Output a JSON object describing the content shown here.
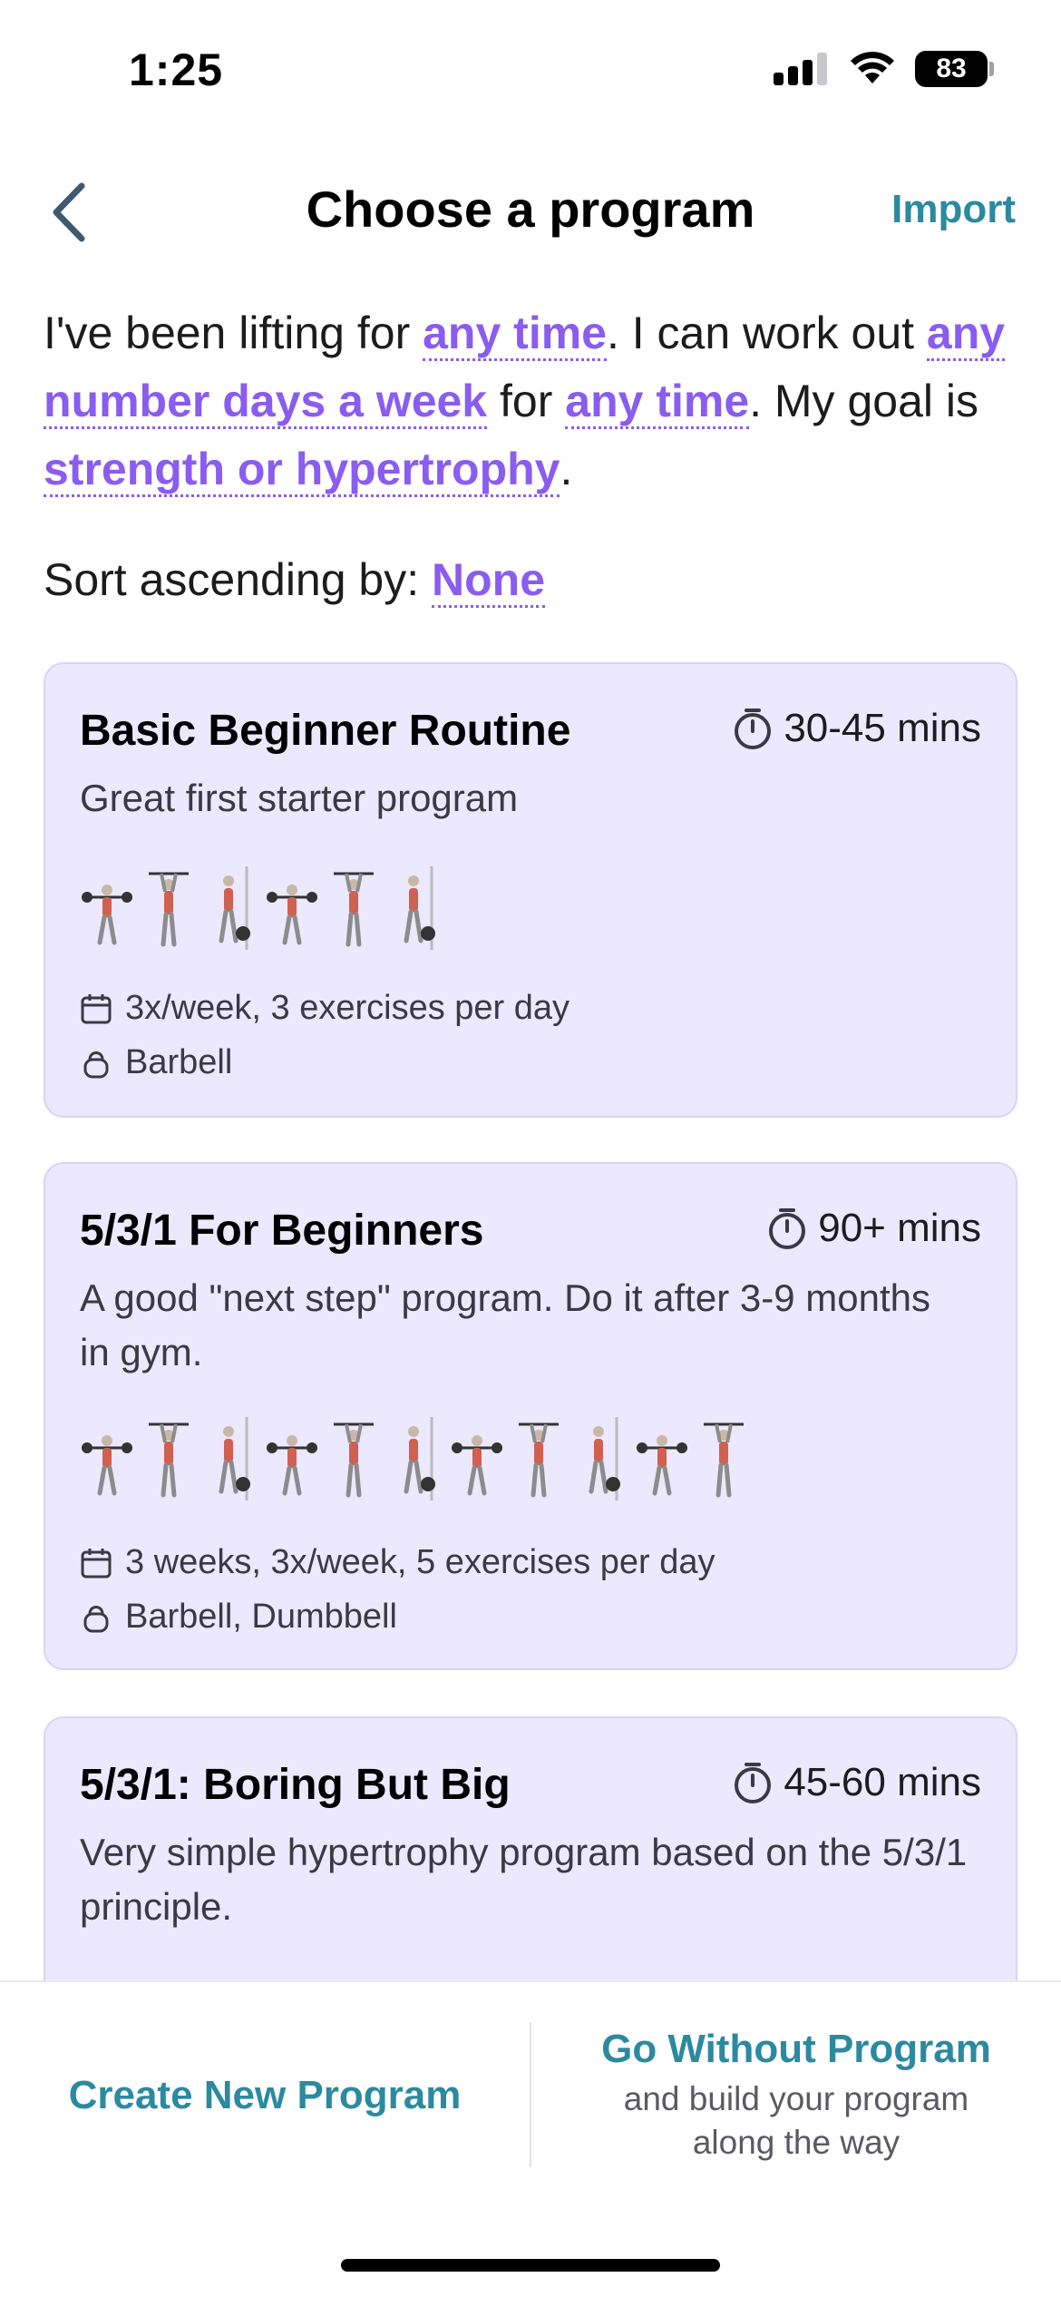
{
  "status_bar": {
    "time": "1:25",
    "battery": "83"
  },
  "nav": {
    "title": "Choose a program",
    "import_label": "Import"
  },
  "filter": {
    "p1": "I've been lifting for ",
    "lifting_duration": "any time",
    "p2": ". I can work out ",
    "days_per_week": "any number days a week",
    "p3": " for ",
    "session_time": "any time",
    "p4": ". My goal is ",
    "goal": "strength or hypertrophy",
    "p5": "."
  },
  "sort": {
    "label": "Sort ascending by: ",
    "value": "None"
  },
  "programs": [
    {
      "title": "Basic Beginner Routine",
      "duration": "30-45 mins",
      "description": "Great first starter program",
      "schedule": "3x/week, 3 exercises per day",
      "equipment": "Barbell",
      "exercise_icon_count": 6
    },
    {
      "title": "5/3/1 For Beginners",
      "duration": "90+ mins",
      "description": "A good \"next step\" program. Do it after 3-9 months in gym.",
      "schedule": "3 weeks, 3x/week, 5 exercises per day",
      "equipment": "Barbell, Dumbbell",
      "exercise_icon_count": 11
    },
    {
      "title": "5/3/1: Boring But Big",
      "duration": "45-60 mins",
      "description": "Very simple hypertrophy program based on the 5/3/1 principle."
    }
  ],
  "bottom": {
    "create_label": "Create New Program",
    "go_title": "Go Without Program",
    "go_subtitle": "and build your program along the way"
  },
  "colors": {
    "accent_purple": "#8a5cf0",
    "accent_teal": "#2b8aa0",
    "card_bg": "#ece8fd"
  },
  "icons": [
    "chevron-left-icon",
    "stopwatch-icon",
    "calendar-icon",
    "kettlebell-icon",
    "exercise-figure-icon"
  ]
}
